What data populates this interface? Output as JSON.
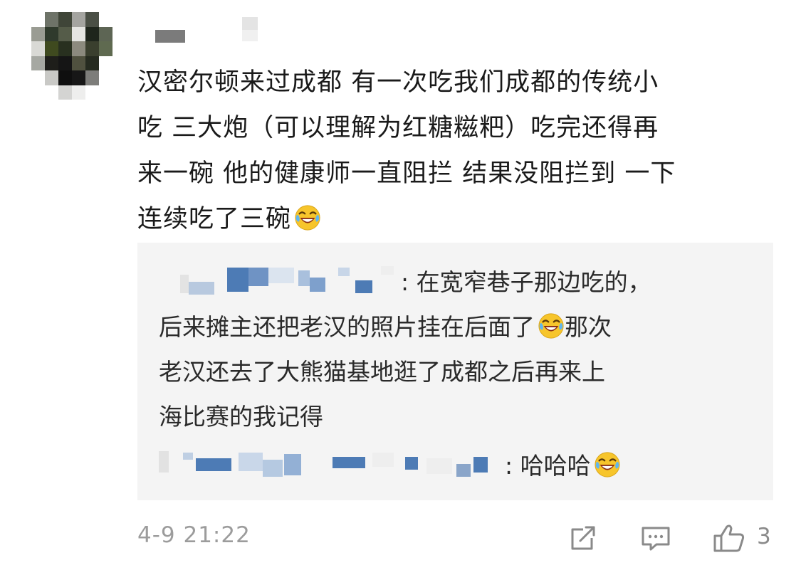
{
  "comment": {
    "line1": "汉密尔顿来过成都 有一次吃我们成都的传统小",
    "line2": "吃 三大炮（可以理解为红糖糍粑）吃完还得再",
    "line3": "来一碗 他的健康师一直阻拦 结果没阻拦到 一下",
    "line4": "连续吃了三碗",
    "emoji_icon": "laughing-crying-emoji"
  },
  "replies": [
    {
      "separator": ": ",
      "line1": "在宽窄巷子那边吃的，",
      "line2": "后来摊主还把老汉的照片挂在后面了",
      "line2_after_emoji": "那次",
      "line3": "老汉还去了大熊猫基地逛了成都之后再来上",
      "line4": "海比赛的我记得"
    },
    {
      "separator": ": ",
      "text": "哈哈哈"
    }
  ],
  "footer": {
    "timestamp": "4-9 21:22",
    "like_count": "3",
    "share_icon": "share-icon",
    "reply_icon": "comment-icon",
    "like_icon": "thumbs-up-icon"
  },
  "colors": {
    "reply_background": "#f4f4f4",
    "timestamp": "#9c9c9c",
    "icon": "#8a8a8a",
    "blur_blue": "#4d7bb5"
  }
}
